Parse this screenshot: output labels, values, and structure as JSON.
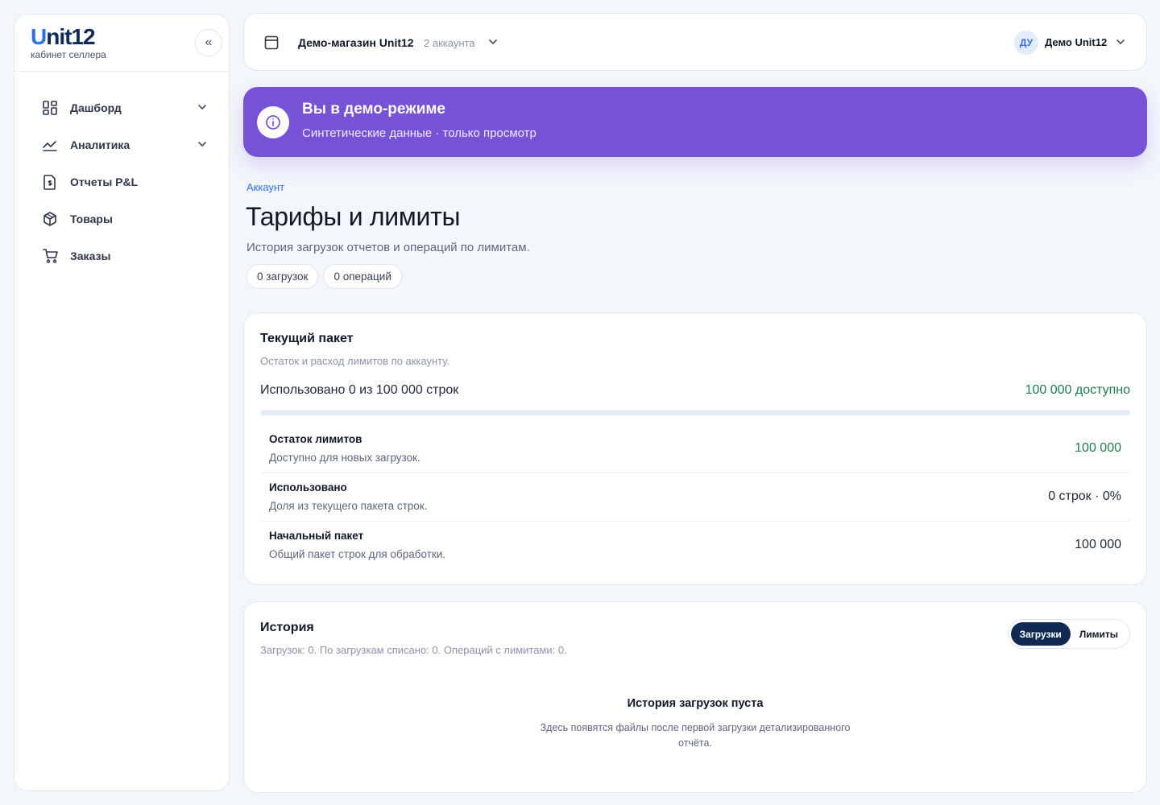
{
  "brand": {
    "logo_u": "U",
    "logo_rest": "nit12",
    "subtitle": "кабинет селлера",
    "collapse_glyph": "«"
  },
  "sidebar": {
    "items": [
      {
        "label": "Дашборд",
        "icon": "dashboard-grid-icon",
        "has_chevron": true
      },
      {
        "label": "Аналитика",
        "icon": "analytics-chart-icon",
        "has_chevron": true
      },
      {
        "label": "Отчеты P&L",
        "icon": "report-document-icon",
        "has_chevron": false
      },
      {
        "label": "Товары",
        "icon": "box-icon",
        "has_chevron": false
      },
      {
        "label": "Заказы",
        "icon": "cart-icon",
        "has_chevron": false
      }
    ]
  },
  "topbar": {
    "store_name": "Демо-магазин Unit12",
    "store_count": "2 аккаунта",
    "user_initials": "ДУ",
    "user_name": "Демо Unit12"
  },
  "banner": {
    "title": "Вы в демо-режиме",
    "subtitle": "Синтетические данные · только просмотр",
    "color": "#7652d6"
  },
  "page": {
    "breadcrumb": "Аккаунт",
    "title": "Тарифы и лимиты",
    "subtitle": "История загрузок отчетов и операций по лимитам.",
    "chips": [
      "0 загрузок",
      "0 операций"
    ]
  },
  "package": {
    "title": "Текущий пакет",
    "subtitle": "Остаток и расход лимитов по аккаунту.",
    "usage_label": "Использовано 0 из 100 000 строк",
    "available_label": "100 000 доступно",
    "usage_fraction": 0,
    "rows": [
      {
        "name": "Остаток лимитов",
        "desc": "Доступно для новых загрузок.",
        "value": "100 000",
        "green": true
      },
      {
        "name": "Использовано",
        "desc": "Доля из текущего пакета строк.",
        "value": "0 строк · 0%",
        "green": false
      },
      {
        "name": "Начальный пакет",
        "desc": "Общий пакет строк для обработки.",
        "value": "100 000",
        "green": false
      }
    ]
  },
  "history": {
    "title": "История",
    "subtitle": "Загрузок: 0. По загрузкам списано: 0. Операций с лимитами: 0.",
    "tabs": [
      {
        "label": "Загрузки",
        "active": true
      },
      {
        "label": "Лимиты",
        "active": false
      }
    ],
    "empty_title": "История загрузок пуста",
    "empty_desc": "Здесь появятся файлы после первой загрузки детализированного отчёта."
  },
  "colors": {
    "accent": "#2e6fe6",
    "success": "#1f7a4d",
    "dark": "#102a52"
  }
}
